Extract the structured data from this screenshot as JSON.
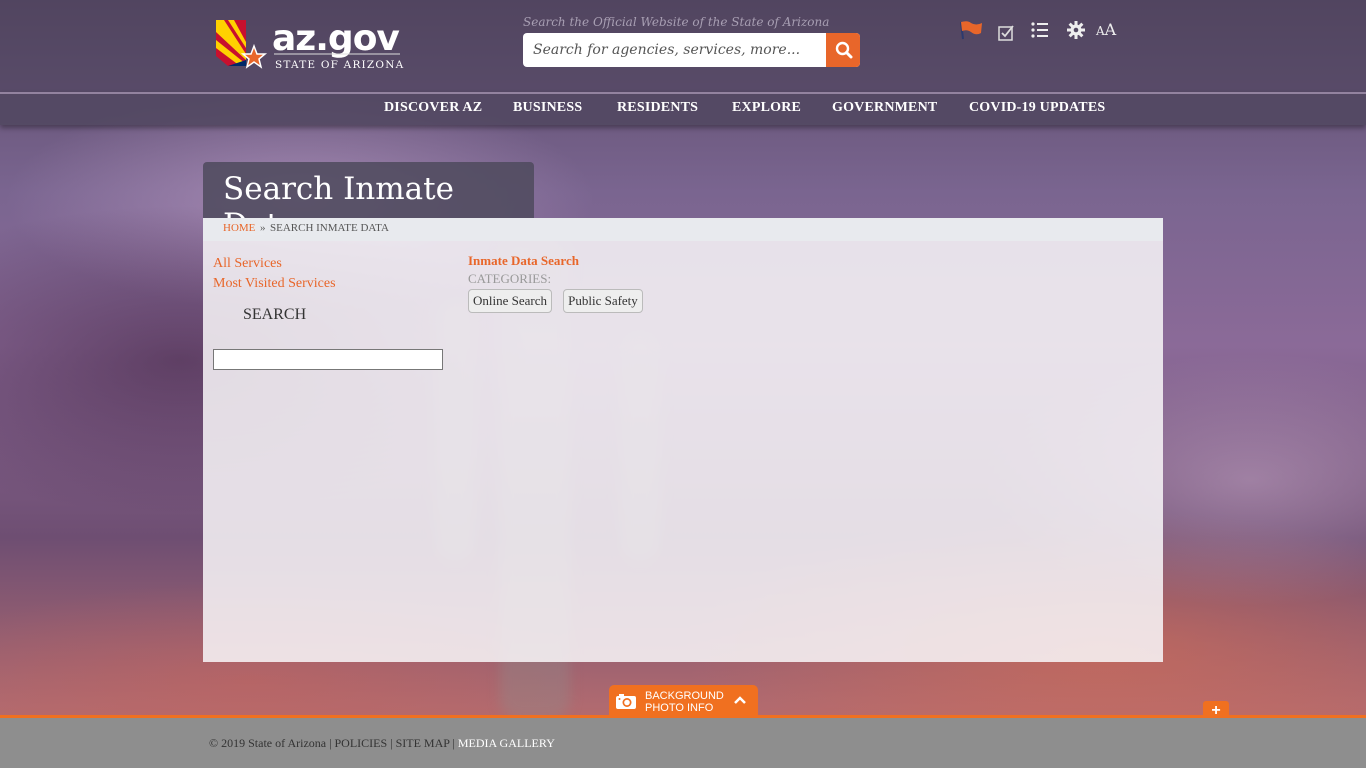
{
  "header": {
    "logo_text": "az.gov",
    "logo_subtext": "STATE OF ARIZONA",
    "search_caption": "Search the Official Website of the State of Arizona",
    "search_placeholder": "Search for agencies, services, more...",
    "utility_icons": [
      "flag-icon",
      "checkbox-icon",
      "list-icon",
      "gear-icon",
      "text-size-icon"
    ],
    "text_size_label": "AA"
  },
  "nav": {
    "items": [
      "DISCOVER AZ",
      "BUSINESS",
      "RESIDENTS",
      "EXPLORE",
      "GOVERNMENT",
      "COVID-19 UPDATES"
    ]
  },
  "page": {
    "title": "Search Inmate Data",
    "breadcrumb": {
      "home": "HOME",
      "separator": "»",
      "current": "SEARCH INMATE DATA"
    }
  },
  "sidebar": {
    "links": [
      "All Services",
      "Most Visited Services"
    ],
    "search_label": "SEARCH",
    "search_value": ""
  },
  "result": {
    "title": "Inmate Data Search",
    "categories_label": "CATEGORIES:",
    "categories": [
      "Online Search",
      "Public Safety"
    ]
  },
  "photo_info": {
    "line1": "BACKGROUND",
    "line2": "PHOTO INFO"
  },
  "footer": {
    "copyright": "© 2019 State of Arizona",
    "sep": "|",
    "links": [
      "POLICIES",
      "SITE MAP",
      "MEDIA GALLERY"
    ]
  },
  "colors": {
    "accent": "#e8662a",
    "nav_bg": "#50465f",
    "footer_bg": "#8e8e8e"
  }
}
